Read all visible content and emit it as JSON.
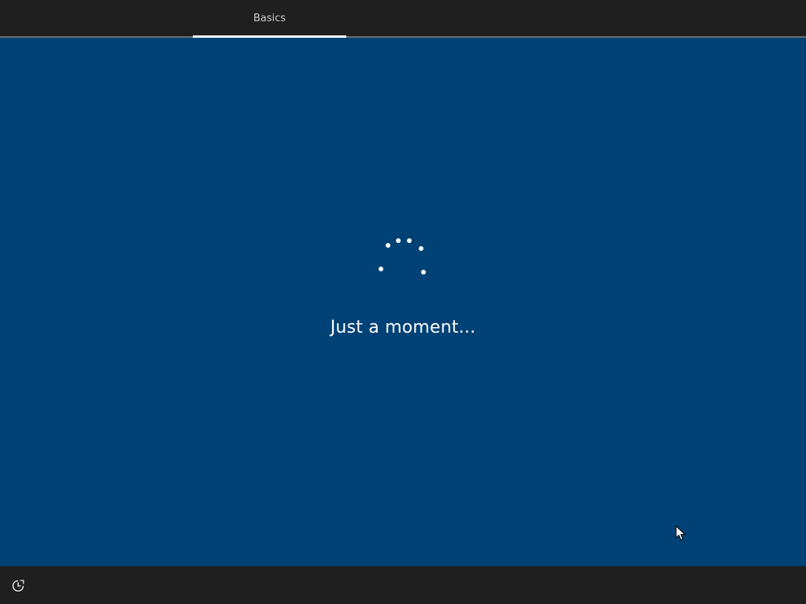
{
  "header": {
    "tabs": [
      {
        "label": "Basics",
        "active": true
      }
    ]
  },
  "main": {
    "status_text": "Just a moment..."
  },
  "footer": {
    "ease_of_access_icon": "ease-of-access-icon"
  },
  "colors": {
    "background": "#004275",
    "bar": "#1f1f1f",
    "text": "#ffffff",
    "tab_text": "#c8c8c8"
  }
}
